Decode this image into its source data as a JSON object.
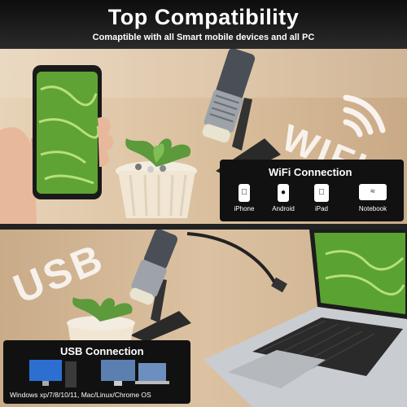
{
  "header": {
    "title": "Top Compatibility",
    "subtitle": "Comaptible with all Smart mobile devices and all PC"
  },
  "wifi": {
    "watermark": "WIFI",
    "section_title": "WiFi Connection",
    "devices": [
      {
        "label": "iPhone",
        "icon": "iphone-icon"
      },
      {
        "label": "Android",
        "icon": "android-icon"
      },
      {
        "label": "iPad",
        "icon": "ipad-icon"
      },
      {
        "label": "Notebook",
        "icon": "notebook-wifi-icon"
      }
    ]
  },
  "usb": {
    "watermark": "USB",
    "section_title": "USB Connection",
    "caption": "Windows xp/7/8/10/11, Mac/Linux/Chrome OS"
  }
}
